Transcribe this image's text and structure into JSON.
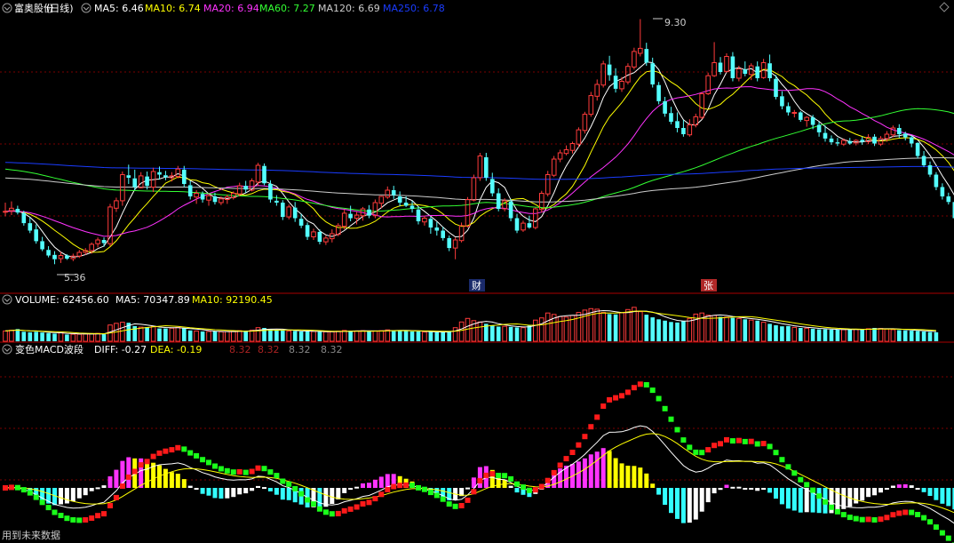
{
  "stock": {
    "name": "富奥股份",
    "period": "(日线)"
  },
  "main_legend": [
    {
      "label": "MA5: 6.46",
      "color": "#ffffff"
    },
    {
      "label": "MA10: 6.74",
      "color": "#ffff00"
    },
    {
      "label": "MA20: 6.94",
      "color": "#ff33ff"
    },
    {
      "label": "MA60: 7.27",
      "color": "#33ff33"
    },
    {
      "label": "MA120: 6.69",
      "color": "#cccccc"
    },
    {
      "label": "MA250: 6.78",
      "color": "#1a3cff"
    }
  ],
  "annotations": {
    "high": "9.30",
    "low": "5.36",
    "mark_cai": "财",
    "mark_zhang": "张"
  },
  "volume_legend": [
    {
      "label": "VOLUME: 62456.60",
      "color": "#ffffff"
    },
    {
      "label": "MA5: 70347.89",
      "color": "#ffffff"
    },
    {
      "label": "MA10: 92190.45",
      "color": "#ffff00"
    }
  ],
  "macd_legend": {
    "title": "变色MACD波段",
    "diff": "DIFF: -0.27",
    "dea": "DEA: -0.19",
    "extra": [
      {
        "label": "8.32",
        "color": "#aa2222"
      },
      {
        "label": "8.32",
        "color": "#aa2222"
      },
      {
        "label": "8.32",
        "color": "#888888"
      },
      {
        "label": "8.32",
        "color": "#888888"
      }
    ]
  },
  "footer": {
    "text": "用到未来数据"
  },
  "colors": {
    "up": "#ff3b3b",
    "down": "#54ffff",
    "grid": "#7a0000",
    "separator": "#aa0000"
  },
  "chart_data": {
    "type": "candlestick",
    "price_range": [
      5.15,
      9.35
    ],
    "ohlc": [
      [
        6.2,
        6.35,
        6.13,
        6.21
      ],
      [
        6.22,
        6.37,
        6.15,
        6.26
      ],
      [
        6.25,
        6.3,
        6.16,
        6.19
      ],
      [
        6.18,
        6.22,
        5.98,
        6.02
      ],
      [
        6.02,
        6.11,
        5.86,
        5.9
      ],
      [
        5.92,
        6.0,
        5.69,
        5.73
      ],
      [
        5.73,
        5.8,
        5.57,
        5.6
      ],
      [
        5.59,
        5.65,
        5.47,
        5.5
      ],
      [
        5.51,
        5.57,
        5.36,
        5.44
      ],
      [
        5.45,
        5.56,
        5.38,
        5.5
      ],
      [
        5.5,
        5.52,
        5.43,
        5.45
      ],
      [
        5.45,
        5.53,
        5.41,
        5.49
      ],
      [
        5.49,
        5.59,
        5.46,
        5.55
      ],
      [
        5.55,
        5.62,
        5.51,
        5.58
      ],
      [
        5.58,
        5.71,
        5.53,
        5.68
      ],
      [
        5.69,
        5.79,
        5.63,
        5.75
      ],
      [
        5.75,
        5.79,
        5.64,
        5.7
      ],
      [
        5.69,
        6.33,
        5.65,
        6.28
      ],
      [
        6.26,
        6.43,
        6.2,
        6.38
      ],
      [
        6.38,
        6.85,
        6.3,
        6.8
      ],
      [
        6.79,
        6.96,
        6.65,
        6.75
      ],
      [
        6.74,
        6.88,
        6.55,
        6.6
      ],
      [
        6.59,
        6.84,
        6.58,
        6.78
      ],
      [
        6.77,
        6.85,
        6.56,
        6.62
      ],
      [
        6.6,
        6.91,
        6.52,
        6.85
      ],
      [
        6.84,
        6.93,
        6.72,
        6.8
      ],
      [
        6.79,
        6.86,
        6.71,
        6.76
      ],
      [
        6.75,
        6.84,
        6.69,
        6.78
      ],
      [
        6.77,
        6.94,
        6.74,
        6.89
      ],
      [
        6.88,
        6.94,
        6.6,
        6.65
      ],
      [
        6.63,
        6.7,
        6.4,
        6.45
      ],
      [
        6.44,
        6.55,
        6.33,
        6.5
      ],
      [
        6.49,
        6.53,
        6.35,
        6.4
      ],
      [
        6.39,
        6.49,
        6.3,
        6.46
      ],
      [
        6.45,
        6.51,
        6.32,
        6.36
      ],
      [
        6.35,
        6.45,
        6.31,
        6.41
      ],
      [
        6.4,
        6.48,
        6.33,
        6.44
      ],
      [
        6.43,
        6.53,
        6.4,
        6.5
      ],
      [
        6.49,
        6.67,
        6.45,
        6.62
      ],
      [
        6.62,
        6.7,
        6.51,
        6.56
      ],
      [
        6.55,
        6.74,
        6.53,
        6.7
      ],
      [
        6.68,
        6.99,
        6.62,
        6.95
      ],
      [
        6.94,
        6.98,
        6.63,
        6.66
      ],
      [
        6.65,
        6.71,
        6.35,
        6.4
      ],
      [
        6.38,
        6.47,
        6.3,
        6.35
      ],
      [
        6.35,
        6.39,
        6.07,
        6.12
      ],
      [
        6.12,
        6.32,
        6.08,
        6.28
      ],
      [
        6.27,
        6.36,
        6.04,
        6.1
      ],
      [
        6.09,
        6.17,
        5.94,
        5.98
      ],
      [
        5.99,
        6.03,
        5.75,
        5.8
      ],
      [
        5.8,
        5.93,
        5.75,
        5.88
      ],
      [
        5.88,
        5.92,
        5.68,
        5.72
      ],
      [
        5.72,
        5.82,
        5.67,
        5.78
      ],
      [
        5.77,
        5.92,
        5.71,
        5.85
      ],
      [
        5.84,
        6.02,
        5.81,
        5.98
      ],
      [
        5.97,
        6.24,
        5.92,
        6.18
      ],
      [
        6.17,
        6.3,
        6.05,
        6.1
      ],
      [
        6.1,
        6.2,
        6.0,
        6.15
      ],
      [
        6.14,
        6.28,
        6.06,
        6.25
      ],
      [
        6.24,
        6.31,
        6.1,
        6.14
      ],
      [
        6.14,
        6.4,
        6.1,
        6.35
      ],
      [
        6.34,
        6.46,
        6.26,
        6.45
      ],
      [
        6.44,
        6.61,
        6.41,
        6.55
      ],
      [
        6.55,
        6.62,
        6.41,
        6.47
      ],
      [
        6.45,
        6.53,
        6.29,
        6.35
      ],
      [
        6.35,
        6.45,
        6.28,
        6.3
      ],
      [
        6.3,
        6.38,
        6.19,
        6.25
      ],
      [
        6.24,
        6.29,
        6.0,
        6.05
      ],
      [
        6.04,
        6.14,
        5.98,
        6.1
      ],
      [
        6.09,
        6.12,
        5.85,
        5.95
      ],
      [
        5.95,
        6.04,
        5.82,
        5.9
      ],
      [
        5.9,
        5.96,
        5.74,
        5.78
      ],
      [
        5.78,
        5.82,
        5.57,
        5.62
      ],
      [
        5.62,
        5.79,
        5.44,
        5.75
      ],
      [
        5.74,
        6.03,
        5.71,
        5.98
      ],
      [
        5.97,
        6.44,
        5.95,
        6.4
      ],
      [
        6.39,
        6.8,
        6.37,
        6.75
      ],
      [
        6.75,
        7.15,
        6.7,
        7.1
      ],
      [
        7.08,
        7.15,
        6.7,
        6.75
      ],
      [
        6.73,
        6.83,
        6.45,
        6.5
      ],
      [
        6.5,
        6.58,
        6.21,
        6.25
      ],
      [
        6.25,
        6.42,
        6.21,
        6.38
      ],
      [
        6.37,
        6.41,
        6.05,
        6.1
      ],
      [
        6.1,
        6.17,
        5.86,
        5.9
      ],
      [
        5.91,
        6.06,
        5.88,
        6.02
      ],
      [
        6.02,
        6.14,
        5.93,
        5.95
      ],
      [
        5.95,
        6.27,
        5.92,
        6.25
      ],
      [
        6.24,
        6.54,
        6.19,
        6.5
      ],
      [
        6.49,
        6.86,
        6.45,
        6.8
      ],
      [
        6.79,
        7.1,
        6.76,
        7.05
      ],
      [
        7.05,
        7.2,
        7.0,
        7.15
      ],
      [
        7.14,
        7.27,
        7.11,
        7.2
      ],
      [
        7.19,
        7.33,
        7.14,
        7.3
      ],
      [
        7.29,
        7.56,
        7.24,
        7.52
      ],
      [
        7.51,
        7.81,
        7.46,
        7.77
      ],
      [
        7.77,
        8.13,
        7.73,
        8.07
      ],
      [
        8.06,
        8.33,
        7.99,
        8.25
      ],
      [
        8.24,
        8.63,
        8.2,
        8.58
      ],
      [
        8.57,
        8.71,
        8.31,
        8.4
      ],
      [
        8.39,
        8.51,
        8.12,
        8.18
      ],
      [
        8.18,
        8.37,
        8.13,
        8.3
      ],
      [
        8.29,
        8.59,
        8.25,
        8.54
      ],
      [
        8.53,
        8.84,
        8.49,
        8.78
      ],
      [
        8.75,
        9.3,
        8.7,
        8.83
      ],
      [
        8.82,
        8.92,
        8.55,
        8.6
      ],
      [
        8.59,
        8.68,
        8.2,
        8.25
      ],
      [
        8.24,
        8.29,
        7.93,
        7.98
      ],
      [
        7.98,
        8.05,
        7.73,
        7.78
      ],
      [
        7.79,
        7.89,
        7.61,
        7.65
      ],
      [
        7.66,
        7.8,
        7.48,
        7.55
      ],
      [
        7.55,
        7.68,
        7.41,
        7.45
      ],
      [
        7.44,
        7.69,
        7.41,
        7.6
      ],
      [
        7.6,
        7.78,
        7.56,
        7.73
      ],
      [
        7.72,
        8.13,
        7.69,
        8.1
      ],
      [
        8.1,
        8.44,
        8.08,
        8.39
      ],
      [
        8.39,
        8.93,
        8.37,
        8.6
      ],
      [
        8.6,
        8.69,
        8.41,
        8.45
      ],
      [
        8.46,
        8.75,
        8.44,
        8.7
      ],
      [
        8.7,
        8.77,
        8.3,
        8.35
      ],
      [
        8.35,
        8.55,
        8.3,
        8.5
      ],
      [
        8.49,
        8.62,
        8.38,
        8.42
      ],
      [
        8.41,
        8.59,
        8.32,
        8.55
      ],
      [
        8.54,
        8.62,
        8.3,
        8.35
      ],
      [
        8.36,
        8.66,
        8.34,
        8.6
      ],
      [
        8.59,
        8.73,
        8.3,
        8.35
      ],
      [
        8.34,
        8.4,
        8.01,
        8.05
      ],
      [
        8.06,
        8.14,
        7.85,
        7.9
      ],
      [
        7.9,
        7.96,
        7.75,
        7.8
      ],
      [
        7.8,
        7.84,
        7.72,
        7.8
      ],
      [
        7.8,
        7.82,
        7.65,
        7.68
      ],
      [
        7.67,
        7.74,
        7.57,
        7.72
      ],
      [
        7.72,
        7.76,
        7.53,
        7.6
      ],
      [
        7.6,
        7.65,
        7.41,
        7.48
      ],
      [
        7.47,
        7.59,
        7.33,
        7.38
      ],
      [
        7.38,
        7.43,
        7.28,
        7.32
      ],
      [
        7.32,
        7.39,
        7.26,
        7.3
      ],
      [
        7.29,
        7.38,
        7.26,
        7.35
      ],
      [
        7.34,
        7.39,
        7.28,
        7.3
      ],
      [
        7.31,
        7.37,
        7.27,
        7.35
      ],
      [
        7.36,
        7.41,
        7.28,
        7.33
      ],
      [
        7.33,
        7.45,
        7.29,
        7.4
      ],
      [
        7.41,
        7.45,
        7.26,
        7.3
      ],
      [
        7.29,
        7.42,
        7.26,
        7.38
      ],
      [
        7.38,
        7.5,
        7.33,
        7.45
      ],
      [
        7.44,
        7.59,
        7.4,
        7.55
      ],
      [
        7.55,
        7.61,
        7.39,
        7.45
      ],
      [
        7.46,
        7.49,
        7.35,
        7.4
      ],
      [
        7.4,
        7.43,
        7.24,
        7.3
      ],
      [
        7.31,
        7.32,
        7.06,
        7.1
      ],
      [
        7.1,
        7.18,
        6.92,
        6.95
      ],
      [
        6.95,
        7.01,
        6.76,
        6.8
      ],
      [
        6.8,
        6.84,
        6.55,
        6.6
      ],
      [
        6.6,
        6.66,
        6.4,
        6.45
      ],
      [
        6.45,
        6.51,
        6.32,
        6.36
      ],
      [
        6.36,
        6.42,
        6.0,
        6.1
      ]
    ],
    "volume": [
      38,
      41,
      45,
      35,
      33,
      35,
      32,
      30,
      28,
      31,
      25,
      26,
      26,
      27,
      28,
      29,
      26,
      60,
      66,
      70,
      68,
      56,
      52,
      52,
      55,
      47,
      47,
      48,
      51,
      48,
      40,
      38,
      36,
      36,
      36,
      35,
      36,
      36,
      39,
      39,
      41,
      50,
      49,
      44,
      40,
      40,
      38,
      38,
      36,
      36,
      36,
      35,
      35,
      35,
      37,
      40,
      39,
      38,
      39,
      36,
      38,
      39,
      42,
      41,
      40,
      38,
      36,
      36,
      34,
      34,
      33,
      34,
      38,
      50,
      71,
      84,
      76,
      71,
      64,
      58,
      54,
      55,
      53,
      51,
      50,
      58,
      78,
      86,
      104,
      99,
      91,
      89,
      95,
      106,
      115,
      120,
      118,
      106,
      100,
      99,
      105,
      117,
      125,
      109,
      98,
      88,
      81,
      76,
      71,
      69,
      75,
      84,
      100,
      104,
      96,
      95,
      90,
      89,
      86,
      84,
      81,
      78,
      76,
      70,
      64,
      59,
      55,
      56,
      51,
      49,
      48,
      46,
      44,
      44,
      43,
      43,
      43,
      44,
      44,
      44,
      46,
      49,
      47,
      45,
      43,
      41,
      40,
      39,
      38,
      36,
      34,
      33
    ],
    "volume_max": 180,
    "ma": [
      {
        "name": "MA5",
        "period": 5,
        "color": "#ffffff"
      },
      {
        "name": "MA10",
        "period": 10,
        "color": "#ffff00"
      },
      {
        "name": "MA20",
        "period": 20,
        "color": "#ff33ff"
      },
      {
        "name": "MA60",
        "period": 60,
        "color": "#33ff33"
      },
      {
        "name": "MA120",
        "period": 120,
        "color": "#cccccc"
      },
      {
        "name": "MA250",
        "period": 250,
        "color": "#1a3cff"
      }
    ],
    "macd": {
      "fast": 12,
      "slow": 26,
      "signal": 9
    }
  }
}
